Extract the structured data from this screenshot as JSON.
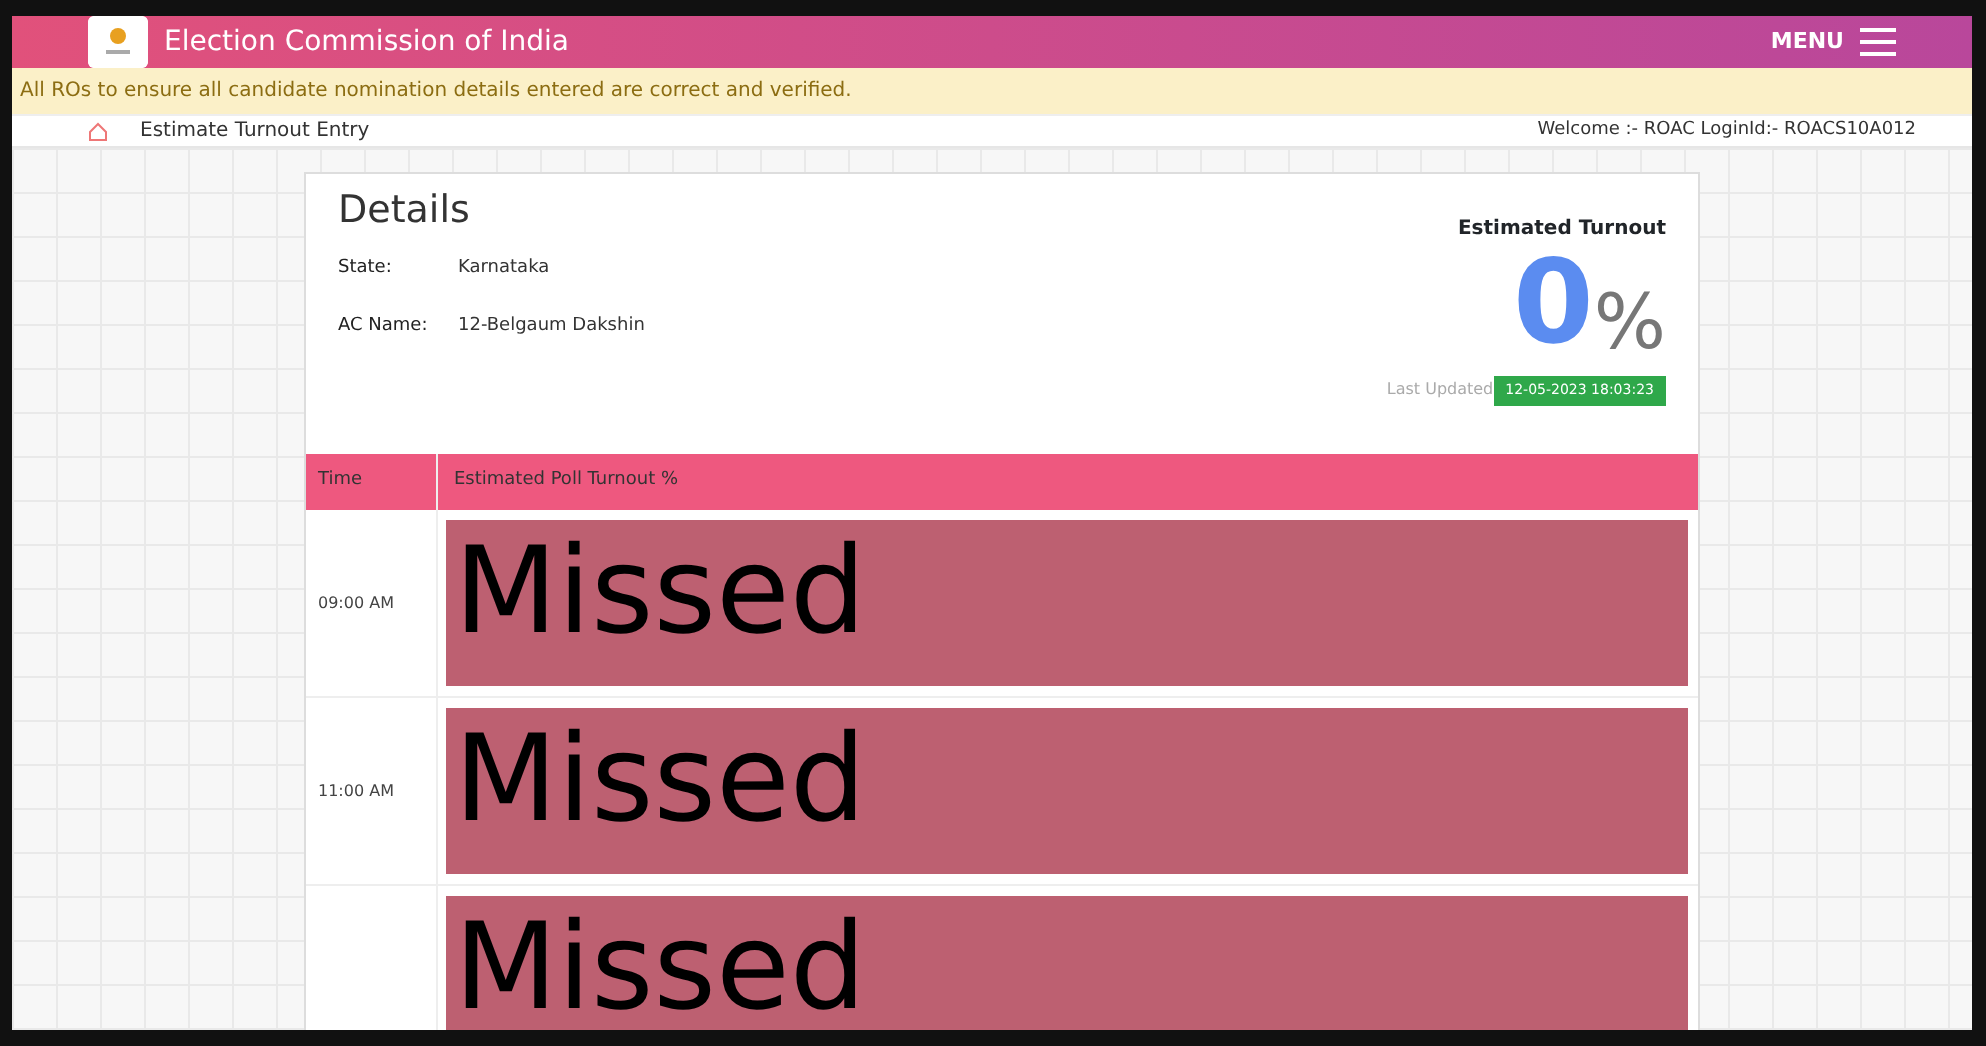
{
  "header": {
    "title": "Election Commission of India",
    "menu_label": "MENU"
  },
  "notice": "All ROs to ensure all candidate nomination details entered are correct and verified.",
  "breadcrumb": {
    "page": "Estimate Turnout Entry",
    "welcome": "Welcome :- ROAC LoginId:- ROACS10A012"
  },
  "details": {
    "title": "Details",
    "fields": [
      {
        "label": "State:",
        "value": "Karnataka"
      },
      {
        "label": "AC Name:",
        "value": "12-Belgaum Dakshin"
      }
    ],
    "turnout": {
      "label": "Estimated Turnout",
      "value": "0",
      "unit": "%",
      "updated_label": "Last Updated",
      "updated_value": "12-05-2023 18:03:23"
    }
  },
  "table": {
    "columns": [
      "Time",
      "Estimated Poll Turnout %"
    ],
    "rows": [
      {
        "time": "09:00 AM",
        "status": "Missed"
      },
      {
        "time": "11:00 AM",
        "status": "Missed"
      },
      {
        "status": "Missed"
      }
    ]
  }
}
